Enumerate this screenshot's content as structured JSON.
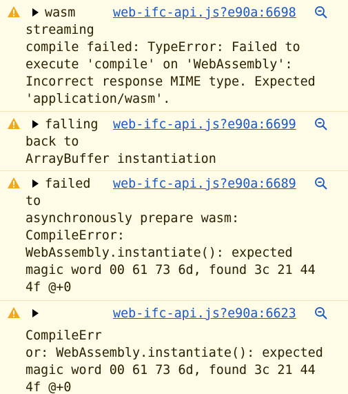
{
  "entries": [
    {
      "head": "wasm",
      "source": "web-ifc-api.js?e90a:6698",
      "lines": [
        "streaming",
        "compile failed: TypeError: Failed to",
        "execute 'compile' on 'WebAssembly':",
        "Incorrect response MIME type. Expected",
        "'application/wasm'."
      ]
    },
    {
      "head": "falling",
      "source": "web-ifc-api.js?e90a:6699",
      "lines": [
        "back to",
        "ArrayBuffer instantiation"
      ]
    },
    {
      "head": "failed",
      "source": "web-ifc-api.js?e90a:6689",
      "lines": [
        "to",
        "asynchronously prepare wasm:",
        "CompileError:",
        "WebAssembly.instantiate(): expected",
        "magic word 00 61 73 6d, found 3c 21 44",
        "4f @+0"
      ]
    },
    {
      "head": "",
      "source": "web-ifc-api.js?e90a:6623",
      "lines": [
        "CompileErr",
        "or: WebAssembly.instantiate(): expected",
        "magic word 00 61 73 6d, found 3c 21 44",
        "4f @+0"
      ]
    }
  ],
  "icons": {
    "warning": "warning-icon",
    "expand": "expand-triangle-icon",
    "search": "search-icon"
  },
  "colors": {
    "background": "#fefbe6",
    "text": "#2a2000",
    "link": "#1a59c8",
    "warning": "#f3a81b",
    "search_icon": "#1a59c8"
  }
}
